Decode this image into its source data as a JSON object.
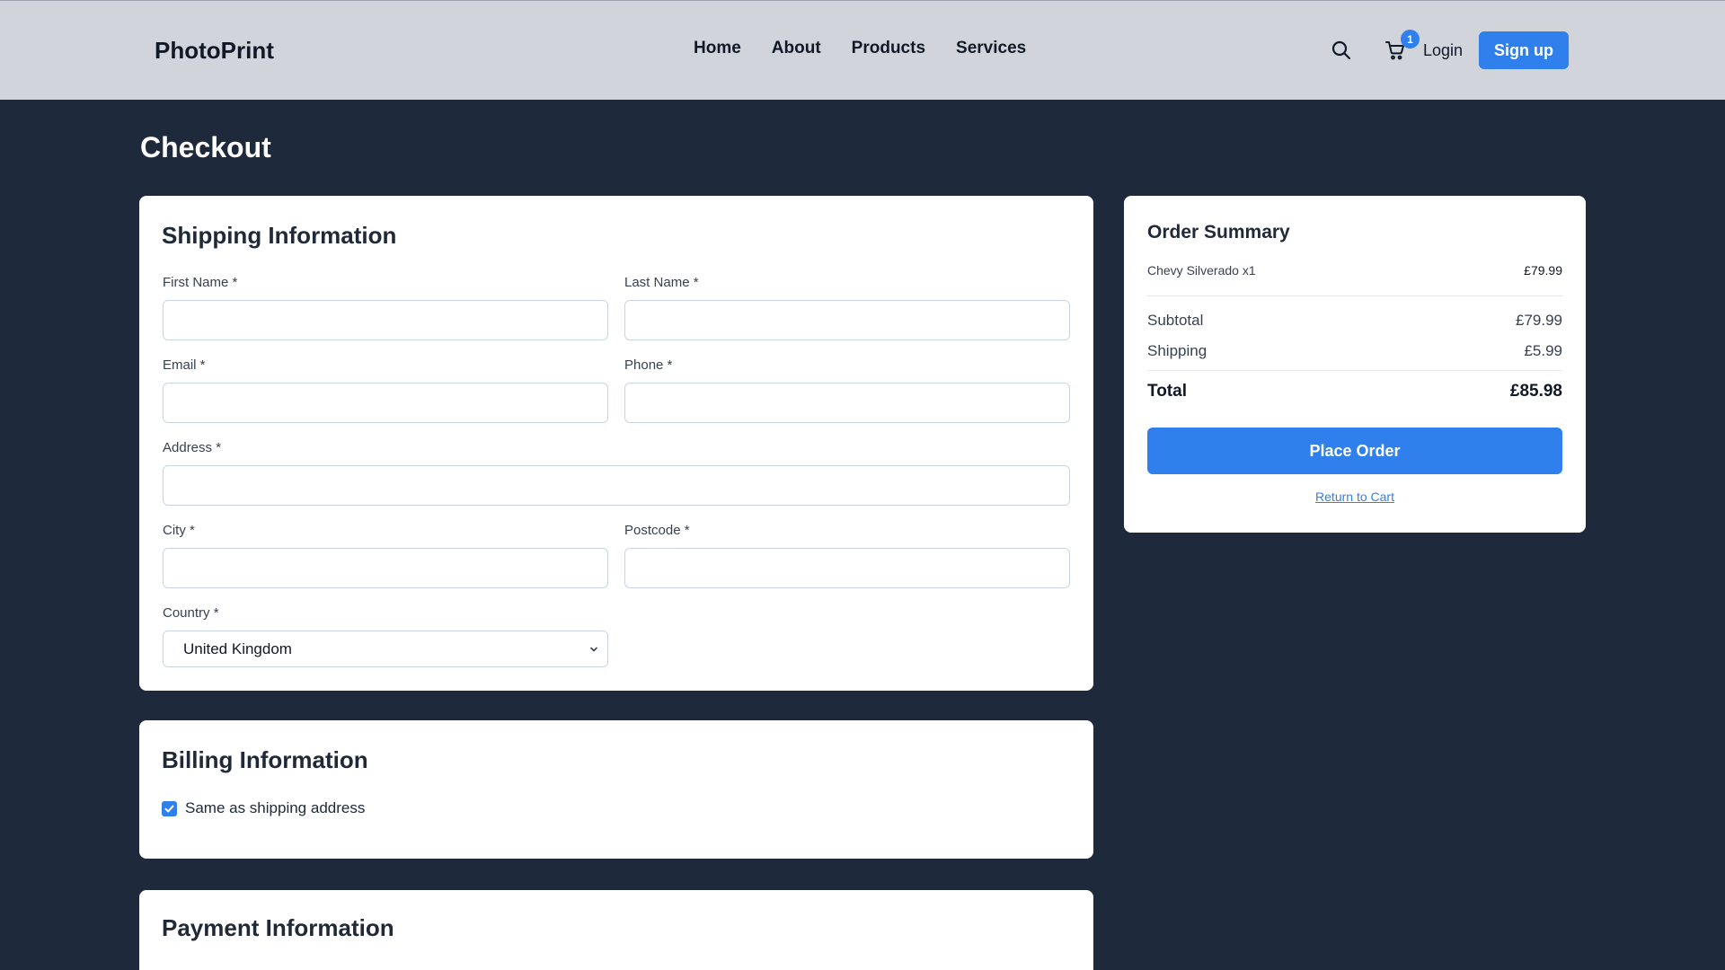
{
  "header": {
    "logo": "PhotoPrint",
    "nav": [
      "Home",
      "About",
      "Products",
      "Services"
    ],
    "cart_count": "1",
    "login_label": "Login",
    "signup_label": "Sign up",
    "icons": {
      "search": "search-icon",
      "cart": "cart-icon"
    }
  },
  "page": {
    "title": "Checkout"
  },
  "shipping": {
    "heading": "Shipping Information",
    "first_name_label": "First Name *",
    "last_name_label": "Last Name *",
    "email_label": "Email *",
    "phone_label": "Phone *",
    "address_label": "Address *",
    "city_label": "City *",
    "postcode_label": "Postcode *",
    "country_label": "Country *",
    "country_value": "United Kingdom",
    "first_name_value": "",
    "last_name_value": "",
    "email_value": "",
    "phone_value": "",
    "address_value": "",
    "city_value": "",
    "postcode_value": ""
  },
  "billing": {
    "heading": "Billing Information",
    "same_as_shipping_label": "Same as shipping address",
    "same_as_shipping_checked": true
  },
  "payment": {
    "heading": "Payment Information"
  },
  "summary": {
    "heading": "Order Summary",
    "item_name": "Chevy Silverado x1",
    "item_price": "£79.99",
    "subtotal_label": "Subtotal",
    "subtotal_value": "£79.99",
    "shipping_label": "Shipping",
    "shipping_value": "£5.99",
    "total_label": "Total",
    "total_value": "£85.98",
    "place_order_label": "Place Order",
    "return_label": "Return to Cart"
  },
  "colors": {
    "accent": "#2f80ed",
    "page_bg": "#1e293b",
    "header_bg": "#d1d5db",
    "card_bg": "#ffffff"
  }
}
